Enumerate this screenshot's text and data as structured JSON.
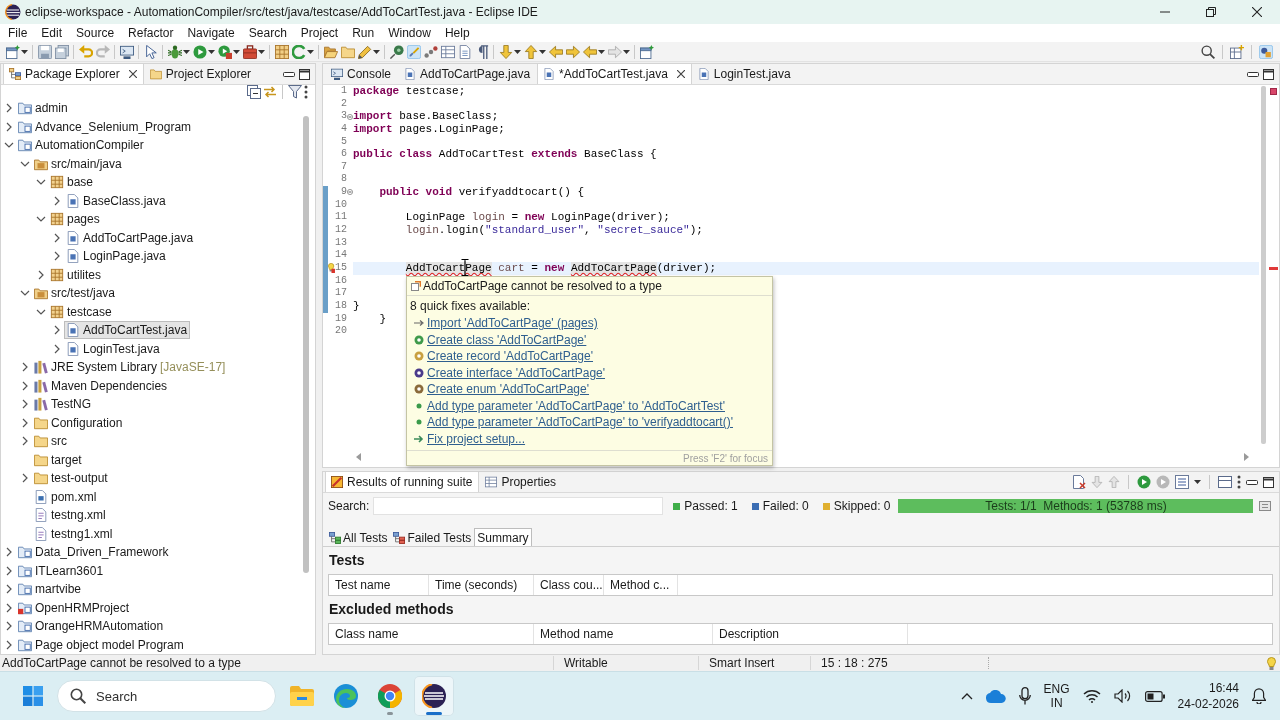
{
  "window": {
    "title": "eclipse-workspace - AutomationCompiler/src/test/java/testcase/AddToCartTest.java - Eclipse IDE"
  },
  "menu": [
    "File",
    "Edit",
    "Source",
    "Refactor",
    "Navigate",
    "Search",
    "Project",
    "Run",
    "Window",
    "Help"
  ],
  "explorer": {
    "tabs": [
      {
        "label": "Package Explorer",
        "kind": "packages",
        "selected": true
      },
      {
        "label": "Project Explorer",
        "kind": "projects",
        "selected": false
      }
    ],
    "tree": [
      {
        "label": "admin",
        "kind": "project",
        "error": false,
        "expanded": false,
        "selected": false
      },
      {
        "label": "Advance_Selenium_Program",
        "kind": "project",
        "error": false,
        "expanded": false,
        "selected": false
      },
      {
        "label": "AutomationCompiler",
        "kind": "project",
        "error": false,
        "expanded": true,
        "selected": false,
        "children": [
          {
            "label": "src/main/java",
            "kind": "source",
            "expanded": true,
            "selected": false,
            "children": [
              {
                "label": "base",
                "kind": "package",
                "expanded": true,
                "selected": false,
                "children": [
                  {
                    "label": "BaseClass.java",
                    "kind": "java",
                    "expanded": false,
                    "selected": false
                  }
                ]
              },
              {
                "label": "pages",
                "kind": "package",
                "expanded": true,
                "selected": false,
                "children": [
                  {
                    "label": "AddToCartPage.java",
                    "kind": "java",
                    "expanded": false,
                    "selected": false
                  },
                  {
                    "label": "LoginPage.java",
                    "kind": "java",
                    "expanded": false,
                    "selected": false
                  }
                ]
              },
              {
                "label": "utilites",
                "kind": "package",
                "expanded": false,
                "selected": false
              }
            ]
          },
          {
            "label": "src/test/java",
            "kind": "source",
            "expanded": true,
            "selected": false,
            "children": [
              {
                "label": "testcase",
                "kind": "package",
                "expanded": true,
                "selected": false,
                "children": [
                  {
                    "label": "AddToCartTest.java",
                    "kind": "java",
                    "expanded": false,
                    "selected": true
                  },
                  {
                    "label": "LoginTest.java",
                    "kind": "java",
                    "expanded": false,
                    "selected": false
                  }
                ]
              }
            ]
          },
          {
            "label": "JRE System Library",
            "decoration": "[JavaSE-17]",
            "kind": "library",
            "expanded": false,
            "selected": false
          },
          {
            "label": "Maven Dependencies",
            "kind": "library",
            "expanded": false,
            "selected": false
          },
          {
            "label": "TestNG",
            "kind": "library",
            "expanded": false,
            "selected": false
          },
          {
            "label": "Configuration",
            "kind": "folder",
            "expanded": false,
            "selected": false
          },
          {
            "label": "src",
            "kind": "folder",
            "expanded": false,
            "selected": false
          },
          {
            "label": "target",
            "kind": "folder",
            "selected": false
          },
          {
            "label": "test-output",
            "kind": "folder",
            "expanded": false,
            "selected": false
          },
          {
            "label": "pom.xml",
            "kind": "pom",
            "selected": false
          },
          {
            "label": "testng.xml",
            "kind": "xml",
            "selected": false
          },
          {
            "label": "testng1.xml",
            "kind": "xml",
            "selected": false
          }
        ]
      },
      {
        "label": "Data_Driven_Framework",
        "kind": "project",
        "error": false,
        "expanded": false,
        "selected": false
      },
      {
        "label": "ITLearn3601",
        "kind": "project",
        "error": false,
        "expanded": false,
        "selected": false
      },
      {
        "label": "martvibe",
        "kind": "project",
        "error": false,
        "expanded": false,
        "selected": false
      },
      {
        "label": "OpenHRMProject",
        "kind": "project",
        "error": true,
        "expanded": false,
        "selected": false
      },
      {
        "label": "OrangeHRMAutomation",
        "kind": "project",
        "error": false,
        "expanded": false,
        "selected": false
      },
      {
        "label": "Page object model Program",
        "kind": "project",
        "error": false,
        "expanded": false,
        "selected": false
      }
    ]
  },
  "editor": {
    "tabs": [
      {
        "label": "Console",
        "kind": "console",
        "selected": false
      },
      {
        "label": "AddToCartPage.java",
        "kind": "java",
        "selected": false
      },
      {
        "label": "*AddToCartTest.java",
        "kind": "java",
        "selected": true
      },
      {
        "label": "LoginTest.java",
        "kind": "java",
        "selected": false
      }
    ],
    "lines": [
      {
        "number": "1",
        "current": false,
        "changed": false,
        "error": false,
        "fold": false,
        "tokens": [
          {
            "kind": "keyword",
            "text": "package"
          },
          {
            "kind": "plain",
            "text": " testcase;"
          }
        ]
      },
      {
        "number": "2",
        "current": false,
        "changed": false,
        "error": false,
        "fold": false
      },
      {
        "number": "3",
        "current": false,
        "changed": false,
        "error": false,
        "fold": true,
        "tokens": [
          {
            "kind": "keyword",
            "text": "import"
          },
          {
            "kind": "plain",
            "text": " base.BaseClass;"
          }
        ]
      },
      {
        "number": "4",
        "current": false,
        "changed": false,
        "error": false,
        "fold": false,
        "tokens": [
          {
            "kind": "keyword",
            "text": "import"
          },
          {
            "kind": "plain",
            "text": " pages.LoginPage;"
          }
        ]
      },
      {
        "number": "5",
        "current": false,
        "changed": false,
        "error": false,
        "fold": false
      },
      {
        "number": "6",
        "current": false,
        "changed": false,
        "error": false,
        "fold": false,
        "tokens": [
          {
            "kind": "keyword",
            "text": "public"
          },
          {
            "kind": "keyword",
            "text": " class"
          },
          {
            "kind": "plain",
            "text": " AddToCartTest "
          },
          {
            "kind": "keyword",
            "text": "extends"
          },
          {
            "kind": "plain",
            "text": " BaseClass {"
          }
        ]
      },
      {
        "number": "7",
        "current": false,
        "changed": false,
        "error": false,
        "fold": false
      },
      {
        "number": "8",
        "current": false,
        "changed": false,
        "error": false,
        "fold": false
      },
      {
        "number": "9",
        "current": false,
        "changed": true,
        "error": false,
        "fold": true,
        "tokens": [
          {
            "kind": "keyword",
            "text": "\tpublic"
          },
          {
            "kind": "keyword",
            "text": " void"
          },
          {
            "kind": "plain",
            "text": " verifyaddtocart() {"
          }
        ]
      },
      {
        "number": "10",
        "current": false,
        "changed": true,
        "error": false,
        "fold": false
      },
      {
        "number": "11",
        "current": false,
        "changed": true,
        "error": false,
        "fold": false,
        "tokens": [
          {
            "kind": "plain",
            "text": "\t\tLoginPage "
          },
          {
            "kind": "local",
            "text": "login"
          },
          {
            "kind": "plain",
            "text": " = "
          },
          {
            "kind": "keyword",
            "text": "new"
          },
          {
            "kind": "plain",
            "text": " LoginPage(driver);"
          }
        ]
      },
      {
        "number": "12",
        "current": false,
        "changed": true,
        "error": false,
        "fold": false,
        "tokens": [
          {
            "kind": "local",
            "text": "\t\tlogin"
          },
          {
            "kind": "plain",
            "text": ".login("
          },
          {
            "kind": "string",
            "text": "\"standard_user\""
          },
          {
            "kind": "plain",
            "text": ", "
          },
          {
            "kind": "string",
            "text": "\"secret_sauce\""
          },
          {
            "kind": "plain",
            "text": ");"
          }
        ]
      },
      {
        "number": "13",
        "current": false,
        "changed": true,
        "error": false,
        "fold": false
      },
      {
        "number": "14",
        "current": false,
        "changed": true,
        "error": false,
        "fold": false
      },
      {
        "number": "15",
        "current": true,
        "changed": true,
        "error": true,
        "fold": false,
        "tokens": [
          {
            "kind": "unresolved",
            "text": "\t\tAddToCartPage"
          },
          {
            "kind": "local",
            "text": " cart"
          },
          {
            "kind": "plain",
            "text": " = "
          },
          {
            "kind": "keyword",
            "text": "new "
          },
          {
            "kind": "unresolved",
            "text": "AddToCartPage"
          },
          {
            "kind": "plain",
            "text": "(driver);"
          }
        ]
      },
      {
        "number": "16",
        "current": false,
        "changed": true,
        "error": false,
        "fold": false
      },
      {
        "number": "17",
        "current": false,
        "changed": true,
        "error": false,
        "fold": false
      },
      {
        "number": "18",
        "current": false,
        "changed": true,
        "error": false,
        "fold": false,
        "tokens": [
          {
            "kind": "plain",
            "text": "}"
          }
        ]
      },
      {
        "number": "19",
        "current": false,
        "changed": false,
        "error": false,
        "fold": false,
        "tokens": [
          {
            "kind": "plain",
            "text": "\t}"
          }
        ]
      },
      {
        "number": "20",
        "current": false,
        "changed": false,
        "error": false,
        "fold": false
      }
    ],
    "hover": {
      "title": "AddToCartPage cannot be resolved to a type",
      "subtitle": "8 quick fixes available:",
      "fixes": [
        {
          "kind": "import",
          "label": "Import 'AddToCartPage' (pages)"
        },
        {
          "kind": "class",
          "label": "Create class 'AddToCartPage'"
        },
        {
          "kind": "record",
          "label": "Create record 'AddToCartPage'"
        },
        {
          "kind": "interface",
          "label": "Create interface 'AddToCartPage'"
        },
        {
          "kind": "enum",
          "label": "Create enum 'AddToCartPage'"
        },
        {
          "kind": "parameter",
          "label": "Add type parameter 'AddToCartPage' to 'AddToCartTest'"
        },
        {
          "kind": "parameter",
          "label": "Add type parameter 'AddToCartPage' to 'verifyaddtocart()'"
        },
        {
          "kind": "setup",
          "label": "Fix project setup..."
        }
      ],
      "footer": "Press 'F2' for focus"
    }
  },
  "results": {
    "tabs": [
      {
        "label": "Results of running suite",
        "kind": "testng",
        "selected": true
      },
      {
        "label": "Properties",
        "kind": "properties",
        "selected": false
      }
    ],
    "search": {
      "label": "Search:"
    },
    "counters": [
      {
        "label": "Passed: 1",
        "color": "#3fae49"
      },
      {
        "label": "Failed: 0",
        "color": "#3c6eb4"
      },
      {
        "label": "Skipped: 0",
        "color": "#e0b030"
      }
    ],
    "progress": {
      "level": 1,
      "text": "Tests: 1/1  Methods: 1 (53788 ms)"
    },
    "views": [
      {
        "label": "All Tests",
        "kind": "all",
        "selected": false
      },
      {
        "label": "Failed Tests",
        "kind": "failed",
        "selected": false
      },
      {
        "label": "Summary",
        "kind": "summary",
        "selected": true
      }
    ],
    "sections": [
      {
        "title": "Tests",
        "columns": [
          "Test name",
          "Time (seconds)",
          "Class cou...",
          "Method c..."
        ]
      },
      {
        "title": "Excluded methods",
        "columns": [
          "Class name",
          "Method name",
          "Description"
        ]
      }
    ]
  },
  "status_bar": {
    "message": "AddToCartPage cannot be resolved to a type",
    "fields": [
      "Writable",
      "Smart Insert",
      "15 : 18 : 275"
    ]
  },
  "taskbar": {
    "search": {
      "placeholder": "Search"
    },
    "apps": [
      {
        "kind": "files",
        "running": false,
        "selected": false
      },
      {
        "kind": "edge",
        "running": false,
        "selected": false
      },
      {
        "kind": "chrome",
        "running": true,
        "selected": false
      },
      {
        "kind": "eclipse",
        "running": true,
        "selected": true
      }
    ],
    "tray": {
      "language": "ENG",
      "region": "IN",
      "time": "16:44",
      "date": "24-02-2026"
    }
  }
}
